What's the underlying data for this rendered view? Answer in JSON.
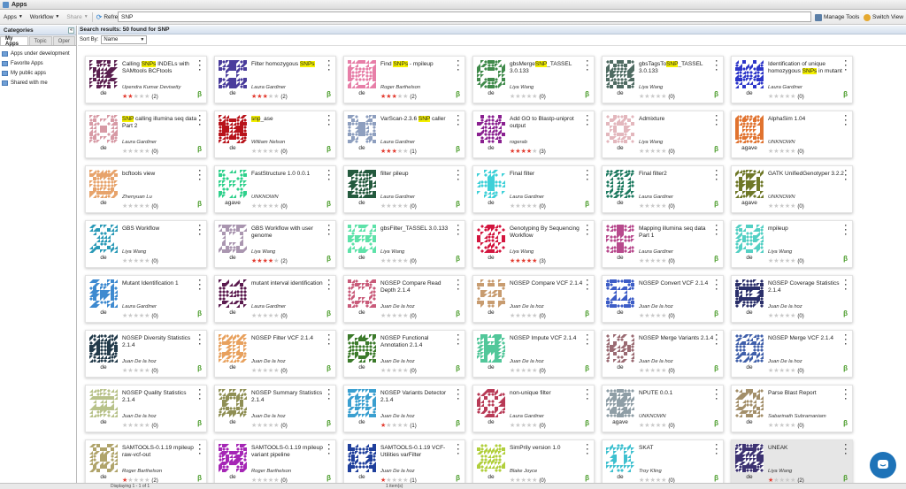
{
  "window": {
    "title": "Apps"
  },
  "toolbar": {
    "apps_label": "Apps",
    "workflow_label": "Workflow",
    "share_label": "Share",
    "refresh_label": "Refresh",
    "search_value": "SNP",
    "manage_tools_label": "Manage Tools",
    "switch_view_label": "Switch View"
  },
  "categories": {
    "title": "Categories",
    "tabs": [
      "My Apps",
      "Topic",
      "Oper"
    ],
    "items": [
      "Apps under development",
      "Favorite Apps",
      "My public apps",
      "Shared with me"
    ]
  },
  "main": {
    "results_label": "Search results: 50 found for SNP",
    "sort_label": "Sort By:",
    "sort_value": "Name"
  },
  "status": {
    "left": "Displaying 1 - 1 of 1",
    "mid": "1 item(s)"
  },
  "palette": [
    "#5a1f4f",
    "#4a3c9c",
    "#e77fa8",
    "#3f8a4a",
    "#4f6b62",
    "#2c35c9",
    "#d79aa5",
    "#b8131a",
    "#8e9fbf",
    "#8a2090",
    "#e3b7bd",
    "#e1732f",
    "#e7a36b",
    "#2fd18c",
    "#245a3e",
    "#3ed0d8",
    "#1e7a60",
    "#6f7828",
    "#2a9ab7",
    "#aa96b0",
    "#5ee2a9",
    "#d3153e",
    "#b84a8d",
    "#53d0c4",
    "#3e8ad0",
    "#5a1a4e",
    "#c95b7a",
    "#c89c70",
    "#3d5dc7",
    "#2a2f6a",
    "#223a4a",
    "#e8a15e",
    "#3b7a2a",
    "#52c79a",
    "#9a6a72",
    "#3f5faa",
    "#b8c28a",
    "#8f8f54",
    "#3a9fd0",
    "#b83a56",
    "#8f9ea6",
    "#a38f6a",
    "#b0a46b",
    "#c48d3a",
    "#a526b5",
    "#1f3f9c",
    "#b1cf3c",
    "#3ec0cf",
    "#3c3272",
    "#3d2f82"
  ],
  "apps": [
    {
      "name": "Calling SNPs INDELs with SAMtools BCFtools",
      "author": "Upendra Kumar Devisetty",
      "integrator": "de",
      "stars": 2,
      "rating_count": "(2)",
      "beta": true,
      "highlight": "SNPs",
      "color": "#5a1f4f"
    },
    {
      "name": "Filter homozygous SNPs",
      "author": "Laura Gardiner",
      "integrator": "de",
      "stars": 3,
      "rating_count": "(2)",
      "beta": true,
      "highlight": "SNPs",
      "color": "#4a3c9c"
    },
    {
      "name": "Find SNPs - mpileup",
      "author": "Roger Barthelson",
      "integrator": "de",
      "stars": 3,
      "rating_count": "(2)",
      "beta": true,
      "highlight": "SNPs",
      "color": "#e77fa8"
    },
    {
      "name": "gbsMergeSNP_TASSEL 3.0.133",
      "author": "Liya Wang",
      "integrator": "de",
      "stars": 0,
      "rating_count": "(0)",
      "beta": true,
      "highlight": "SNP",
      "color": "#3f8a4a"
    },
    {
      "name": "gbsTagsToSNP_TASSEL 3.0.133",
      "author": "Liya Wang",
      "integrator": "de",
      "stars": 0,
      "rating_count": "(0)",
      "beta": true,
      "highlight": "SNP",
      "color": "#4f6b62"
    },
    {
      "name": "Identification of unique homozygous SNPs in mutant",
      "author": "Laura Gardiner",
      "integrator": "de",
      "stars": 0,
      "rating_count": "(0)",
      "beta": true,
      "highlight": "SNPs",
      "color": "#2c35c9"
    },
    {
      "name": "SNP calling illumina seq data Part 2",
      "author": "Laura Gardiner",
      "integrator": "de",
      "stars": 0,
      "rating_count": "(0)",
      "beta": true,
      "highlight": "SNP",
      "color": "#d79aa5"
    },
    {
      "name": "snp_ase",
      "author": "William Nelson",
      "integrator": "de",
      "stars": 0,
      "rating_count": "(0)",
      "beta": true,
      "highlight": "snp",
      "color": "#b8131a"
    },
    {
      "name": "VarScan-2.3.6 SNP caller",
      "author": "Laura Gardiner",
      "integrator": "de",
      "stars": 3,
      "rating_count": "(1)",
      "beta": true,
      "highlight": "SNP",
      "color": "#8e9fbf"
    },
    {
      "name": "Add GO to Blastp-uniprot output",
      "author": "rogerab",
      "integrator": "de",
      "stars": 4,
      "rating_count": "(3)",
      "beta": false,
      "highlight": "",
      "color": "#8a2090"
    },
    {
      "name": "Admixture",
      "author": "Liya Wang",
      "integrator": "de",
      "stars": 0,
      "rating_count": "(0)",
      "beta": true,
      "highlight": "",
      "color": "#e3b7bd"
    },
    {
      "name": "AlphaSim 1.04",
      "author": "UNKNOWN",
      "integrator": "agave",
      "stars": 0,
      "rating_count": "(0)",
      "beta": false,
      "highlight": "",
      "color": "#e1732f"
    },
    {
      "name": "bcftools view",
      "author": "Zhenyuan Lu",
      "integrator": "de",
      "stars": 0,
      "rating_count": "(0)",
      "beta": true,
      "highlight": "",
      "color": "#e7a36b"
    },
    {
      "name": "FastStructure 1.0 0.0.1",
      "author": "UNKNOWN",
      "integrator": "agave",
      "stars": 0,
      "rating_count": "(0)",
      "beta": true,
      "highlight": "",
      "color": "#2fd18c"
    },
    {
      "name": "filter pileup",
      "author": "Laura Gardiner",
      "integrator": "de",
      "stars": 0,
      "rating_count": "(0)",
      "beta": true,
      "highlight": "",
      "color": "#245a3e"
    },
    {
      "name": "Final filter",
      "author": "Laura Gardiner",
      "integrator": "de",
      "stars": 0,
      "rating_count": "(0)",
      "beta": true,
      "highlight": "",
      "color": "#3ed0d8"
    },
    {
      "name": "Final filter2",
      "author": "Laura Gardiner",
      "integrator": "de",
      "stars": 0,
      "rating_count": "(0)",
      "beta": true,
      "highlight": "",
      "color": "#1e7a60"
    },
    {
      "name": "GATK UnifiedGenotyper 3.2.2",
      "author": "UNKNOWN",
      "integrator": "agave",
      "stars": 0,
      "rating_count": "(0)",
      "beta": false,
      "highlight": "",
      "color": "#6f7828"
    },
    {
      "name": "GBS Workflow",
      "author": "Liya Wang",
      "integrator": "de",
      "stars": 0,
      "rating_count": "(0)",
      "beta": false,
      "highlight": "",
      "color": "#2a9ab7"
    },
    {
      "name": "GBS Workflow with user genome",
      "author": "Liya Wang",
      "integrator": "de",
      "stars": 4,
      "rating_count": "(2)",
      "beta": true,
      "highlight": "",
      "color": "#aa96b0"
    },
    {
      "name": "gbsFilter_TASSEL 3.0.133",
      "author": "Liya Wang",
      "integrator": "de",
      "stars": 0,
      "rating_count": "(0)",
      "beta": true,
      "highlight": "",
      "color": "#5ee2a9"
    },
    {
      "name": "Genotyping By Sequencing Workflow",
      "author": "Liya Wang",
      "integrator": "de",
      "stars": 5,
      "rating_count": "(3)",
      "beta": false,
      "highlight": "",
      "color": "#d3153e"
    },
    {
      "name": "Mapping illumina seq data Part 1",
      "author": "Laura Gardiner",
      "integrator": "de",
      "stars": 0,
      "rating_count": "(0)",
      "beta": true,
      "highlight": "",
      "color": "#b84a8d"
    },
    {
      "name": "mpileup",
      "author": "Liya Wang",
      "integrator": "de",
      "stars": 0,
      "rating_count": "(0)",
      "beta": true,
      "highlight": "",
      "color": "#53d0c4"
    },
    {
      "name": "Mutant Identification 1",
      "author": "Laura Gardiner",
      "integrator": "de",
      "stars": 0,
      "rating_count": "(0)",
      "beta": true,
      "highlight": "",
      "color": "#3e8ad0"
    },
    {
      "name": "mutant interval identification",
      "author": "Laura Gardiner",
      "integrator": "de",
      "stars": 0,
      "rating_count": "(0)",
      "beta": true,
      "highlight": "",
      "color": "#5a1a4e"
    },
    {
      "name": "NGSEP Compare Read Depth 2.1.4",
      "author": "Juan De la hoz",
      "integrator": "de",
      "stars": 0,
      "rating_count": "(0)",
      "beta": true,
      "highlight": "",
      "color": "#c95b7a"
    },
    {
      "name": "NGSEP Compare VCF 2.1.4",
      "author": "Juan De la hoz",
      "integrator": "de",
      "stars": 0,
      "rating_count": "(0)",
      "beta": true,
      "highlight": "",
      "color": "#c89c70"
    },
    {
      "name": "NGSEP Convert VCF 2.1.4",
      "author": "Juan De la hoz",
      "integrator": "de",
      "stars": 0,
      "rating_count": "(0)",
      "beta": true,
      "highlight": "",
      "color": "#3d5dc7"
    },
    {
      "name": "NGSEP Coverage Statistics 2.1.4",
      "author": "Juan De la hoz",
      "integrator": "de",
      "stars": 0,
      "rating_count": "(0)",
      "beta": true,
      "highlight": "",
      "color": "#2a2f6a"
    },
    {
      "name": "NGSEP Diversity Statistics 2.1.4",
      "author": "Juan De la hoz",
      "integrator": "de",
      "stars": 0,
      "rating_count": "(0)",
      "beta": true,
      "highlight": "",
      "color": "#223a4a"
    },
    {
      "name": "NGSEP Filter VCF 2.1.4",
      "author": "Juan De la hoz",
      "integrator": "de",
      "stars": 0,
      "rating_count": "(0)",
      "beta": true,
      "highlight": "",
      "color": "#e8a15e"
    },
    {
      "name": "NGSEP Functional Annotation 2.1.4",
      "author": "Juan De la hoz",
      "integrator": "de",
      "stars": 0,
      "rating_count": "(0)",
      "beta": true,
      "highlight": "",
      "color": "#3b7a2a"
    },
    {
      "name": "NGSEP Impute VCF 2.1.4",
      "author": "Juan De la hoz",
      "integrator": "de",
      "stars": 0,
      "rating_count": "(0)",
      "beta": true,
      "highlight": "",
      "color": "#52c79a"
    },
    {
      "name": "NGSEP Merge Variants 2.1.4",
      "author": "Juan De la hoz",
      "integrator": "de",
      "stars": 0,
      "rating_count": "(0)",
      "beta": true,
      "highlight": "",
      "color": "#9a6a72"
    },
    {
      "name": "NGSEP Merge VCF 2.1.4",
      "author": "Juan De la hoz",
      "integrator": "de",
      "stars": 0,
      "rating_count": "(0)",
      "beta": true,
      "highlight": "",
      "color": "#3f5faa"
    },
    {
      "name": "NGSEP Quality Statistics 2.1.4",
      "author": "Juan De la hoz",
      "integrator": "de",
      "stars": 0,
      "rating_count": "(0)",
      "beta": true,
      "highlight": "",
      "color": "#b8c28a"
    },
    {
      "name": "NGSEP Summary Statistics 2.1.4",
      "author": "Juan De la hoz",
      "integrator": "de",
      "stars": 0,
      "rating_count": "(0)",
      "beta": true,
      "highlight": "",
      "color": "#8f8f54"
    },
    {
      "name": "NGSEP Variants Detector 2.1.4",
      "author": "Juan De la hoz",
      "integrator": "de",
      "stars": 1,
      "rating_count": "(1)",
      "beta": true,
      "highlight": "",
      "color": "#3a9fd0"
    },
    {
      "name": "non-unique filter",
      "author": "Laura Gardiner",
      "integrator": "de",
      "stars": 0,
      "rating_count": "(0)",
      "beta": true,
      "highlight": "",
      "color": "#b83a56"
    },
    {
      "name": "NPUTE 0.0.1",
      "author": "UNKNOWN",
      "integrator": "agave",
      "stars": 0,
      "rating_count": "(0)",
      "beta": true,
      "highlight": "",
      "color": "#8f9ea6"
    },
    {
      "name": "Parse Blast Report",
      "author": "Sabarinath Subramaniam",
      "integrator": "de",
      "stars": 0,
      "rating_count": "(0)",
      "beta": true,
      "highlight": "",
      "color": "#a38f6a"
    },
    {
      "name": "SAMTOOLS-0.1.19 mpileup raw-vcf-out",
      "author": "Roger Barthelson",
      "integrator": "de",
      "stars": 1,
      "rating_count": "(2)",
      "beta": true,
      "highlight": "",
      "color": "#b0a46b"
    },
    {
      "name": "SAMTOOLS-0.1.19 mpileup variant pipeline",
      "author": "Roger Barthelson",
      "integrator": "de",
      "stars": 0,
      "rating_count": "(0)",
      "beta": true,
      "highlight": "",
      "color": "#a526b5"
    },
    {
      "name": "SAMTOOLS-0.1.19 VCF-Utilities varFilter",
      "author": "Juan De la hoz",
      "integrator": "de",
      "stars": 1,
      "rating_count": "(1)",
      "beta": true,
      "highlight": "",
      "color": "#1f3f9c"
    },
    {
      "name": "SimPrily version 1.0",
      "author": "Blake Joyce",
      "integrator": "de",
      "stars": 0,
      "rating_count": "(0)",
      "beta": true,
      "highlight": "",
      "color": "#b1cf3c"
    },
    {
      "name": "SKAT",
      "author": "Troy Kling",
      "integrator": "de",
      "stars": 0,
      "rating_count": "(0)",
      "beta": true,
      "highlight": "",
      "color": "#3ec0cf"
    },
    {
      "name": "UNEAK",
      "author": "Liya Wang",
      "integrator": "de",
      "stars": 1,
      "rating_count": "(2)",
      "beta": true,
      "highlight": "",
      "color": "#3c3272"
    }
  ]
}
